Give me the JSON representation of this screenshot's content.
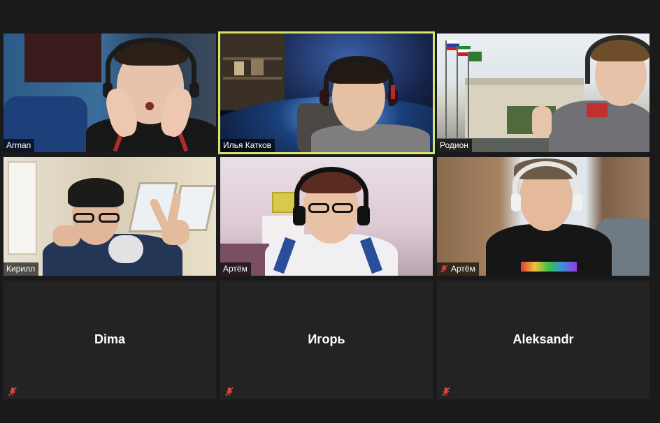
{
  "participants": [
    {
      "name": "Arman"
    },
    {
      "name": "Илья Катков"
    },
    {
      "name": "Родион"
    },
    {
      "name": "Кирилл"
    },
    {
      "name": "Артём"
    },
    {
      "name": "Артём"
    },
    {
      "name": "Dima"
    },
    {
      "name": "Игорь"
    },
    {
      "name": "Aleksandr"
    }
  ],
  "colors": {
    "active_speaker_border": "#d6e56a",
    "mute": "#e0443a"
  },
  "icons": {
    "mute": "microphone-muted-icon"
  }
}
